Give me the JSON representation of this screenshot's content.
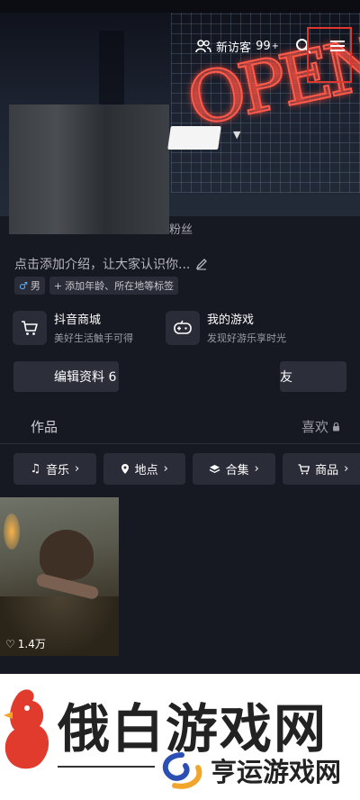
{
  "header": {
    "visitor_label": "新访客",
    "visitor_count": "99",
    "visitor_plus": "+",
    "neon_sign": "OPEN"
  },
  "profile": {
    "fans_label": "粉丝",
    "intro_placeholder": "点击添加介绍，让大家认识你...",
    "gender_tag": "男",
    "add_tags_label": "添加年龄、所在地等标签"
  },
  "services": [
    {
      "title": "抖音商城",
      "subtitle": "美好生活触手可得"
    },
    {
      "title": "我的游戏",
      "subtitle": "发现好游乐享时光"
    }
  ],
  "buttons": {
    "edit_profile": "编辑资料 6",
    "add_friend": "友"
  },
  "tabs": {
    "works": "作品",
    "likes": "喜欢"
  },
  "filters": [
    {
      "label": "音乐",
      "icon": "music-note-icon"
    },
    {
      "label": "地点",
      "icon": "location-pin-icon"
    },
    {
      "label": "合集",
      "icon": "stack-icon"
    },
    {
      "label": "商品",
      "icon": "cart-icon"
    }
  ],
  "video": {
    "likes": "1.4万"
  },
  "watermark": {
    "brand_main": "俄白游戏网",
    "brand_sub": "亨运游戏网"
  },
  "colors": {
    "background": "#161822",
    "card": "#2a2c37",
    "highlight": "#e0362c"
  }
}
